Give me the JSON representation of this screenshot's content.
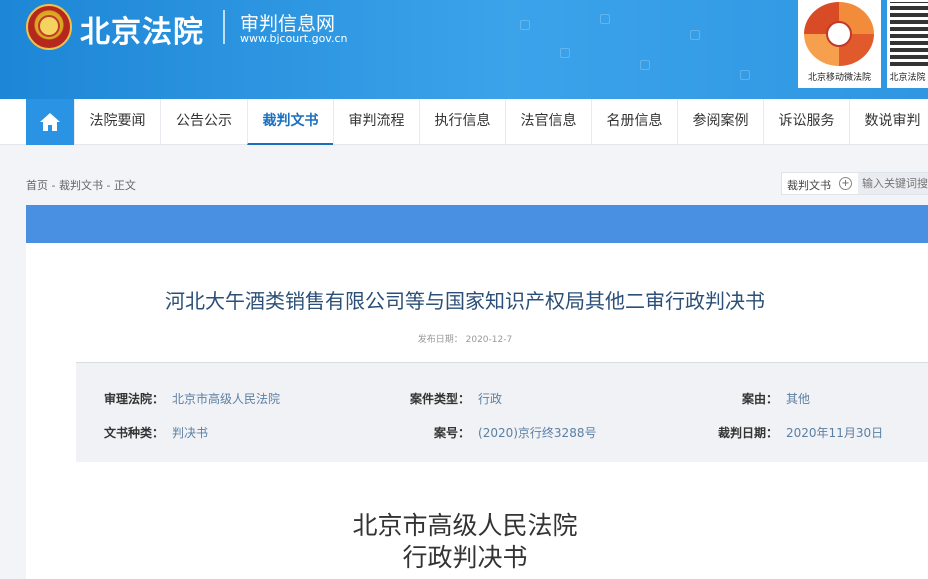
{
  "header": {
    "site_name": "北京法院",
    "sub_name": "审判信息网",
    "sub_url": "www.bjcourt.gov.cn",
    "qr_labels": [
      "北京移动微法院",
      "北京法院"
    ]
  },
  "nav": {
    "items": [
      "法院要闻",
      "公告公示",
      "裁判文书",
      "审判流程",
      "执行信息",
      "法官信息",
      "名册信息",
      "参阅案例",
      "诉讼服务",
      "数说审判"
    ],
    "active": "裁判文书"
  },
  "breadcrumb": "首页 - 裁判文书 - 正文",
  "search": {
    "label": "裁判文书",
    "placeholder": "输入关键词搜索"
  },
  "document": {
    "title": "河北大午酒类销售有限公司等与国家知识产权局其他二审行政判决书",
    "publish_date": "发布日期：  2020-12-7",
    "meta": {
      "court_label": "审理法院：",
      "court": "北京市高级人民法院",
      "case_type_label": "案件类型：",
      "case_type": "行政",
      "cause_label": "案由：",
      "cause": "其他",
      "doc_type_label": "文书种类：",
      "doc_type": "判决书",
      "case_no_label": "案号：",
      "case_no": "(2020)京行终3288号",
      "judgment_date_label": "裁判日期：",
      "judgment_date": "2020年11月30日"
    },
    "court_heading": "北京市高级人民法院",
    "doc_heading": "行政判决书"
  },
  "colors": {
    "header_blue": "#2b93e3",
    "nav_active": "#1b6fbf",
    "title_blue": "#2b4f78",
    "bar_blue": "#4a90e2"
  }
}
